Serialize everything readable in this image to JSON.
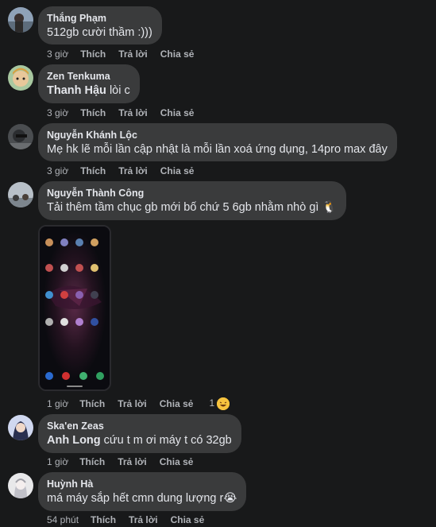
{
  "comments": [
    {
      "name": "Thắng Phạm",
      "mention": "",
      "text": "512gb cười thầm :)))",
      "time": "3 giờ",
      "like": "Thích",
      "reply": "Trả lời",
      "share": "Chia sẻ"
    },
    {
      "name": "Zen Tenkuma",
      "mention": "Thanh Hậu",
      "text": " lòi c",
      "time": "3 giờ",
      "like": "Thích",
      "reply": "Trả lời",
      "share": "Chia sẻ"
    },
    {
      "name": "Nguyễn Khánh Lộc",
      "mention": "",
      "text": "Mẹ hk lẽ mỗi lần cập nhật là mỗi lần xoá ứng dụng, 14pro max đây",
      "time": "3 giờ",
      "like": "Thích",
      "reply": "Trả lời",
      "share": "Chia sẻ"
    },
    {
      "name": "Nguyễn Thành Công",
      "mention": "",
      "text": "Tải thêm tầm chục gb mới bố chứ 5 6gb nhằm nhò gì 🐧",
      "time": "1 giờ",
      "like": "Thích",
      "reply": "Trả lời",
      "share": "Chia sẻ",
      "reaction_count": "1"
    },
    {
      "name": "Ska'en Zeas",
      "mention": "Anh Long",
      "text": " cứu t m ơi máy t có 32gb",
      "time": "1 giờ",
      "like": "Thích",
      "reply": "Trả lời",
      "share": "Chia sẻ"
    },
    {
      "name": "Huỳnh Hà",
      "mention": "",
      "text": "má máy sắp hết cmn dung lượng r😭",
      "time": "54 phút",
      "like": "Thích",
      "reply": "Trả lời",
      "share": "Chia sẻ"
    }
  ],
  "colors": {
    "background": "#18191a",
    "bubble": "#3a3b3c",
    "text": "#e4e6eb",
    "secondary": "#b0b3b8"
  }
}
